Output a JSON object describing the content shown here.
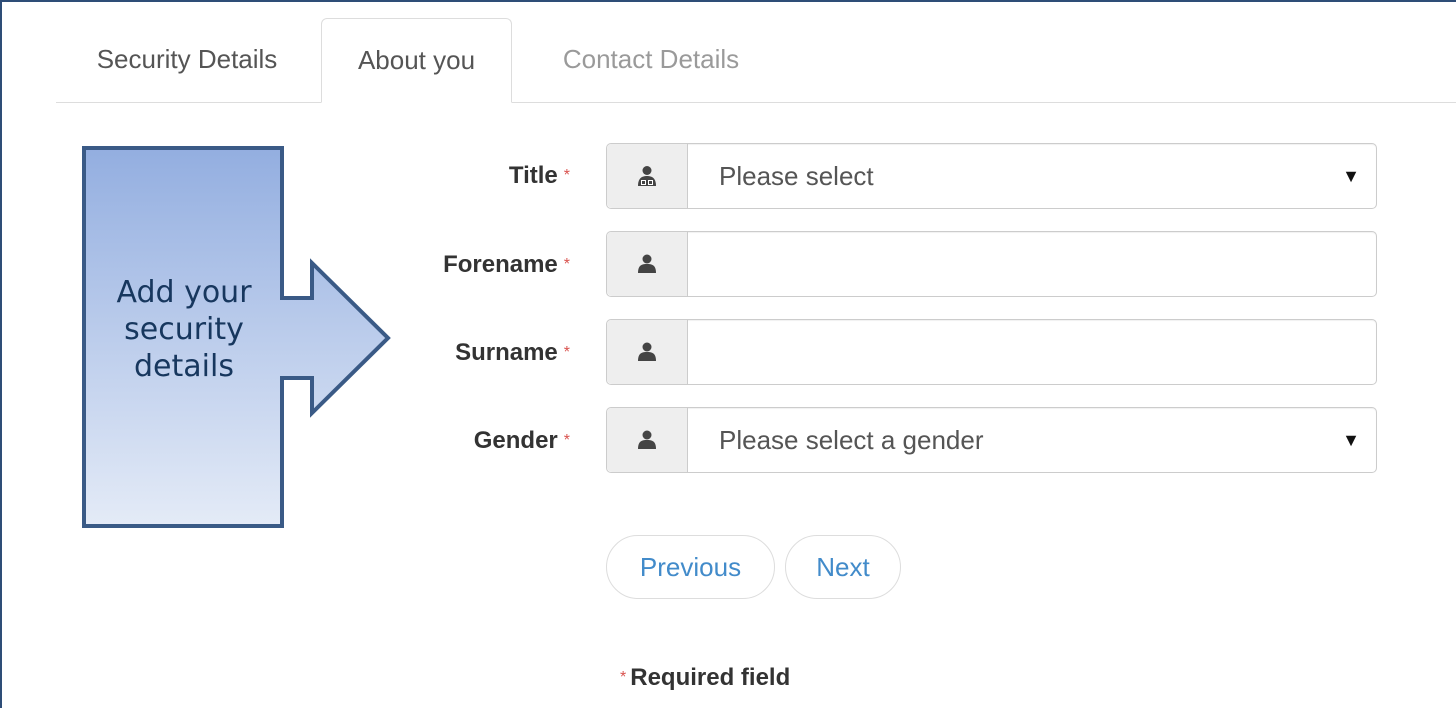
{
  "tabs": [
    {
      "label": "Security Details",
      "state": "inactive"
    },
    {
      "label": "About you",
      "state": "active"
    },
    {
      "label": "Contact Details",
      "state": "disabled"
    }
  ],
  "callout": {
    "text": "Add your security details",
    "fill_top": "#93aee0",
    "fill_bottom": "#e4ebf7",
    "border": "#3a5a86"
  },
  "form": {
    "required_marker": "*",
    "title": {
      "label": "Title",
      "icon": "user-tie-icon",
      "value": "Please select"
    },
    "forename": {
      "label": "Forename",
      "icon": "user-icon",
      "value": ""
    },
    "surname": {
      "label": "Surname",
      "icon": "user-icon",
      "value": ""
    },
    "gender": {
      "label": "Gender",
      "icon": "user-icon",
      "value": "Please select a gender"
    }
  },
  "buttons": {
    "previous": "Previous",
    "next": "Next"
  },
  "footer": {
    "required_note": "Required field"
  },
  "colors": {
    "link": "#428bca",
    "required": "#d9534f",
    "frame": "#2e4d77"
  }
}
